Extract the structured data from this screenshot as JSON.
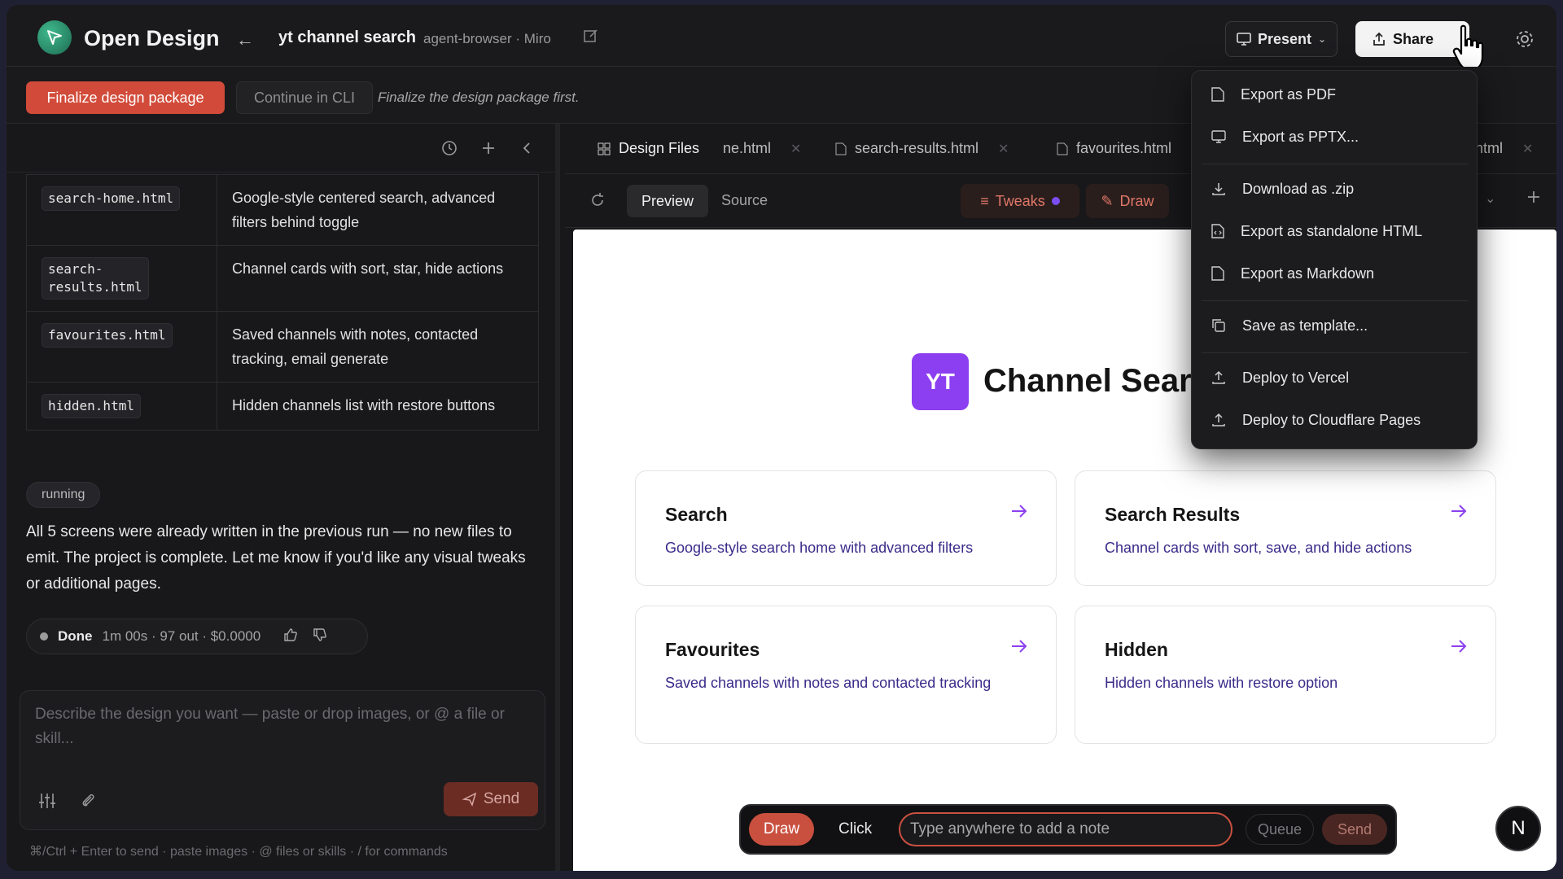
{
  "app": {
    "name": "Open Design"
  },
  "project": {
    "title": "yt channel search",
    "meta": "agent-browser · Miro"
  },
  "header": {
    "present_label": "Present",
    "share_label": "Share"
  },
  "actions": {
    "finalize_label": "Finalize design package",
    "cli_label": "Continue in CLI",
    "hint": "Finalize the design package first."
  },
  "files_table": [
    {
      "file": "search-home.html",
      "desc": "Google-style centered search, advanced filters behind toggle"
    },
    {
      "file": "search-\nresults.html",
      "desc": "Channel cards with sort, star, hide actions"
    },
    {
      "file": "favourites.html",
      "desc": "Saved channels with notes, contacted tracking, email generate"
    },
    {
      "file": "hidden.html",
      "desc": "Hidden channels list with restore buttons"
    }
  ],
  "chat": {
    "status_badge": "running",
    "message": "All 5 screens were already written in the previous run — no new files to emit. The project is complete. Let me know if you'd like any visual tweaks or additional pages.",
    "done_label": "Done",
    "done_stats": "1m 00s · 97 out · $0.0000"
  },
  "composer": {
    "placeholder": "Describe the design you want — paste or drop images, or @ a file or skill...",
    "send_label": "Send",
    "hint": "⌘/Ctrl + Enter to send · paste images · @ files or skills · / for commands"
  },
  "tabs": {
    "design_files": "Design Files",
    "items": [
      "ne.html",
      "search-results.html",
      "favourites.html",
      "html"
    ]
  },
  "viewbar": {
    "preview": "Preview",
    "source": "Source",
    "tweaks": "Tweaks",
    "draw": "Draw"
  },
  "preview": {
    "logo_text": "YT",
    "title": "Channel Sear",
    "cards": [
      {
        "title": "Search",
        "desc": "Google-style search home with advanced filters"
      },
      {
        "title": "Search Results",
        "desc": "Channel cards with sort, save, and hide actions"
      },
      {
        "title": "Favourites",
        "desc": "Saved channels with notes and contacted tracking"
      },
      {
        "title": "Hidden",
        "desc": "Hidden channels with restore option"
      }
    ]
  },
  "floatbar": {
    "draw": "Draw",
    "click": "Click",
    "placeholder": "Type anywhere to add a note",
    "queue": "Queue",
    "send": "Send"
  },
  "avatar": {
    "initial": "N"
  },
  "share_menu": {
    "items": [
      {
        "label": "Export as PDF",
        "icon": "file-icon"
      },
      {
        "label": "Export as PPTX...",
        "icon": "monitor-icon"
      },
      {
        "label": "Download as .zip",
        "icon": "download-icon"
      },
      {
        "label": "Export as standalone HTML",
        "icon": "file-code-icon"
      },
      {
        "label": "Export as Markdown",
        "icon": "file-icon"
      },
      {
        "label": "Save as template...",
        "icon": "copy-icon"
      },
      {
        "label": "Deploy to Vercel",
        "icon": "upload-icon"
      },
      {
        "label": "Deploy to Cloudflare Pages",
        "icon": "upload-icon"
      }
    ]
  },
  "colors": {
    "accent_red": "#d24b3a",
    "accent_purple": "#8c3ff0",
    "card_text": "#3b2a8a"
  }
}
